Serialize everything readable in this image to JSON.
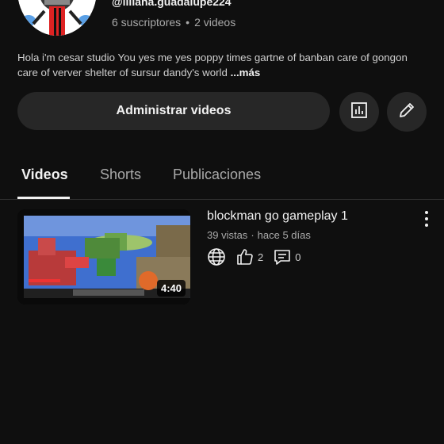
{
  "channel": {
    "handle": "@liliana.guadalupe224",
    "subscribers": "6 suscriptores",
    "separator": "•",
    "video_count": "2 videos",
    "description": "Hola i'm cesar studio You yes me yes poppy times gartne of banban care of gongon care of verver shelter of sursur dandy's world ",
    "more_label": "...más"
  },
  "actions": {
    "manage_label": "Administrar videos",
    "analytics_icon": "analytics-icon",
    "edit_icon": "pencil-icon"
  },
  "tabs": [
    {
      "label": "Videos",
      "active": true
    },
    {
      "label": "Shorts",
      "active": false
    },
    {
      "label": "Publicaciones",
      "active": false
    }
  ],
  "videos": [
    {
      "title": "blockman go gameplay 1",
      "views": "39 vistas",
      "separator": "·",
      "age": "hace 5 días",
      "duration": "4:40",
      "likes": "2",
      "comments": "0",
      "visibility_icon": "globe-icon"
    }
  ],
  "colors": {
    "background": "#0f0f0f",
    "surface": "#272727",
    "text_primary": "#f1f1f1",
    "text_secondary": "#aaaaaa"
  }
}
